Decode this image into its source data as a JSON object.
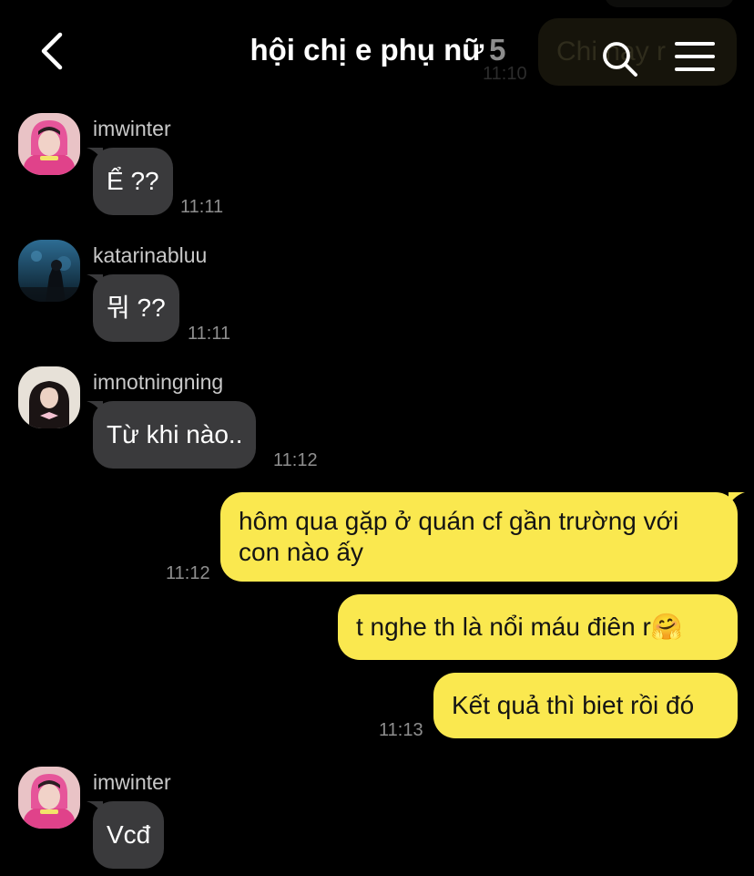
{
  "header": {
    "title": "hội chị e phụ nữ",
    "member_count": "5",
    "back_icon": "chevron-left-icon",
    "search_icon": "search-icon",
    "menu_icon": "menu-icon"
  },
  "scrolled_message": {
    "text": "Chi nay r",
    "time": "11:10"
  },
  "messages": [
    {
      "direction": "incoming",
      "sender": "imwinter",
      "text": "Ể ??",
      "time": "11:11"
    },
    {
      "direction": "incoming",
      "sender": "katarinabluu",
      "text": "뭐 ??",
      "time": "11:11"
    },
    {
      "direction": "incoming",
      "sender": "imnotningning",
      "text": "Từ khi nào..",
      "time": "11:12"
    },
    {
      "direction": "outgoing",
      "line1": "hôm qua gặp ở quán cf gần trường với",
      "line2": "con nào ấy",
      "time": "11:12"
    },
    {
      "direction": "outgoing",
      "text": "t nghe th là nổi máu điên r",
      "emoji": "🤗"
    },
    {
      "direction": "outgoing",
      "text": "Kết quả thì biet rồi đó",
      "time": "11:13"
    },
    {
      "direction": "incoming",
      "sender": "imwinter",
      "text": "Vcđ"
    }
  ],
  "colors": {
    "background": "#000000",
    "incoming_bubble": "#3a3a3c",
    "outgoing_bubble": "#fae84f",
    "timestamp": "#8e8e8e"
  }
}
